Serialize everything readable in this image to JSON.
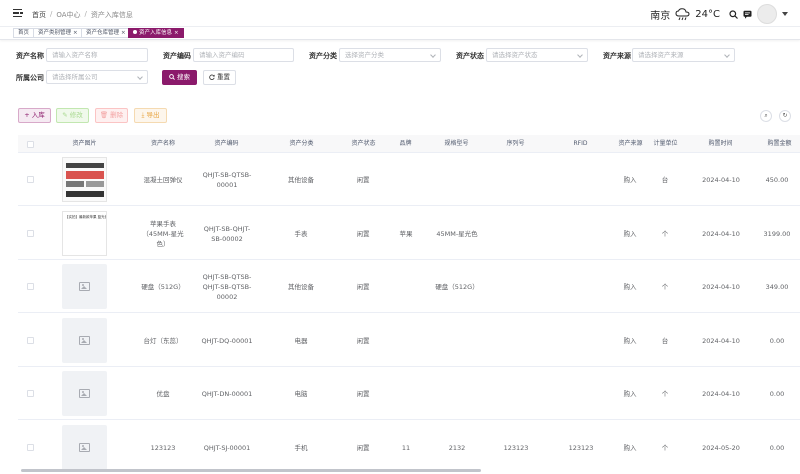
{
  "breadcrumb": [
    "首页",
    "OA中心",
    "资产入库信息"
  ],
  "weather": {
    "city": "南京",
    "temperature": "24°C",
    "icon": "cloud-rain-icon"
  },
  "tabs": [
    {
      "label": "首页",
      "closable": false,
      "active": false
    },
    {
      "label": "资产类别管理",
      "closable": true,
      "active": false
    },
    {
      "label": "资产仓库管理",
      "closable": true,
      "active": false
    },
    {
      "label": "资产入库信息",
      "closable": true,
      "active": true
    }
  ],
  "search": {
    "fields": [
      {
        "label": "资产名称",
        "placeholder": "请输入资产名称",
        "select": false
      },
      {
        "label": "资产编码",
        "placeholder": "请输入资产编码",
        "select": false
      },
      {
        "label": "资产分类",
        "placeholder": "选择资产分类",
        "select": true
      },
      {
        "label": "资产状态",
        "placeholder": "请选择资产状态",
        "select": true
      },
      {
        "label": "资产来源",
        "placeholder": "请选择资产来源",
        "select": true
      },
      {
        "label": "所属公司",
        "placeholder": "请选择所属公司",
        "select": true
      }
    ],
    "search_label": "搜索",
    "reset_label": "重置"
  },
  "toolbar": {
    "add_label": "入库",
    "edit_label": "修改",
    "delete_label": "删除",
    "export_label": "导出"
  },
  "table": {
    "columns": [
      "资产图片",
      "资产名称",
      "资产编码",
      "资产分类",
      "资产状态",
      "品牌",
      "规格型号",
      "序列号",
      "RFID",
      "资产来源",
      "计量单位",
      "购置时间",
      "购置金额"
    ],
    "rows": [
      {
        "image": "photo-1",
        "name": "混凝土回弹仪",
        "code": "QHJT-SB-QTSB-00001",
        "category": "其他设备",
        "status": "闲置",
        "brand": "",
        "model": "",
        "serial": "",
        "rfid": "",
        "source": "购入",
        "unit": "台",
        "date": "2024-04-10",
        "amount": "450.00"
      },
      {
        "image": "photo-2",
        "image_text": "【实拍】最新款苹果 蓝光色",
        "name": "苹果手表（45MM-星光色）",
        "code": "QHJT-SB-QHJT-SB-00002",
        "category": "手表",
        "status": "闲置",
        "brand": "苹果",
        "model": "45MM-星光色",
        "serial": "",
        "rfid": "",
        "source": "购入",
        "unit": "个",
        "date": "2024-04-10",
        "amount": "3199.00"
      },
      {
        "image": "placeholder",
        "name": "硬盘（512G）",
        "code": "QHJT-SB-QTSB-QHJT-SB-QTSB-00002",
        "category": "其他设备",
        "status": "闲置",
        "brand": "",
        "model": "硬盘（512G）",
        "serial": "",
        "rfid": "",
        "source": "购入",
        "unit": "个",
        "date": "2024-04-10",
        "amount": "349.00"
      },
      {
        "image": "placeholder",
        "name": "台灯（东蕊）",
        "code": "QHJT-DQ-00001",
        "category": "电器",
        "status": "闲置",
        "brand": "",
        "model": "",
        "serial": "",
        "rfid": "",
        "source": "购入",
        "unit": "台",
        "date": "2024-04-10",
        "amount": "0.00"
      },
      {
        "image": "placeholder",
        "name": "优盘",
        "code": "QHJT-DN-00001",
        "category": "电脑",
        "status": "闲置",
        "brand": "",
        "model": "",
        "serial": "",
        "rfid": "",
        "source": "购入",
        "unit": "个",
        "date": "2024-04-10",
        "amount": "0.00"
      },
      {
        "image": "placeholder",
        "name": "123123",
        "code": "QHJT-SJ-00001",
        "category": "手机",
        "status": "闲置",
        "brand": "11",
        "model": "2132",
        "serial": "123123",
        "rfid": "123123",
        "source": "购入",
        "unit": "个",
        "date": "2024-05-20",
        "amount": "0.00"
      }
    ]
  },
  "colors": {
    "primary": "#8b1a6b"
  }
}
